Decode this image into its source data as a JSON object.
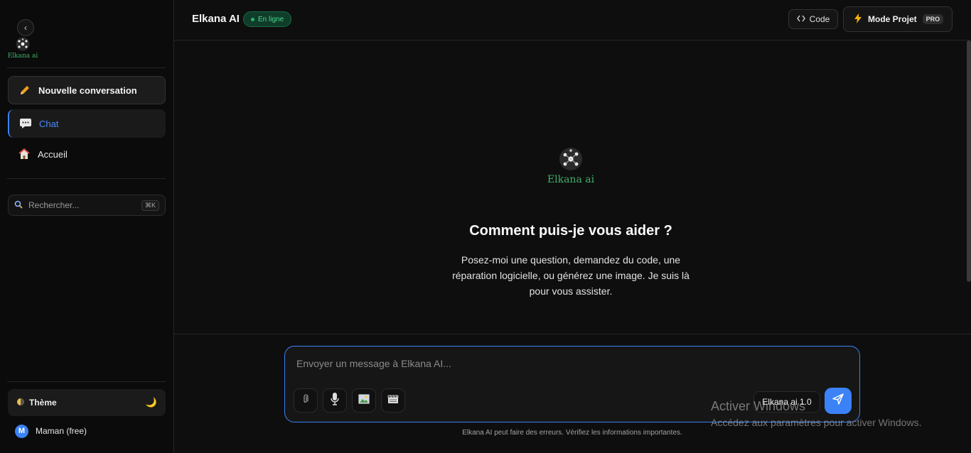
{
  "sidebar": {
    "logo_text": "Elkana ai",
    "new_conversation": "Nouvelle conversation",
    "items": [
      {
        "label": "Chat",
        "icon": "chat-icon"
      },
      {
        "label": "Accueil",
        "icon": "home-icon"
      }
    ],
    "search": {
      "placeholder": "Rechercher...",
      "shortcut": "⌘K"
    },
    "theme_label": "Thème",
    "user": {
      "initial": "M",
      "name": "Maman (free)"
    }
  },
  "header": {
    "title": "Elkana AI",
    "status": "En ligne",
    "code_label": "Code",
    "project_label": "Mode Projet",
    "pro_badge": "PRO"
  },
  "main": {
    "logo_text": "Elkana ai",
    "headline": "Comment puis-je vous aider ?",
    "subtitle": "Posez-moi une question, demandez du code, une réparation logicielle, ou générez une image. Je suis là pour vous assister."
  },
  "composer": {
    "placeholder": "Envoyer un message à Elkana AI...",
    "model": "Elkana ai 1.0",
    "disclaimer": "Elkana AI peut faire des erreurs. Vérifiez les informations importantes."
  },
  "watermark": {
    "line1": "Activer Windows",
    "line2": "Accédez aux paramètres pour activer Windows."
  },
  "colors": {
    "accent": "#3b82f6",
    "online": "#2ab36a",
    "brand_text": "#3fae6a"
  }
}
